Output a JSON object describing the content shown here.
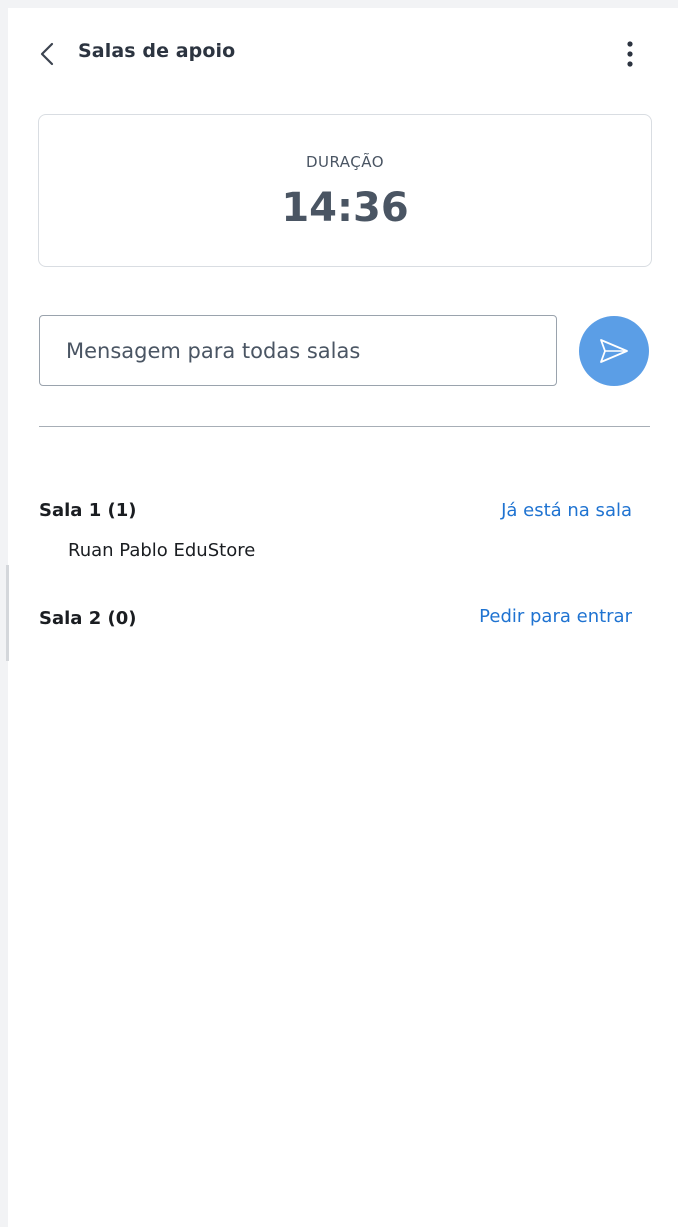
{
  "header": {
    "title": "Salas de apoio",
    "back_icon": "chevron-left-icon",
    "menu_icon": "more-vertical-icon"
  },
  "duration": {
    "label": "DURAÇÃO",
    "value": "14:36"
  },
  "message": {
    "placeholder": "Mensagem para todas salas",
    "value": "",
    "send_icon": "send-icon",
    "send_color": "#5b9ee6"
  },
  "rooms": [
    {
      "name": "Sala 1 (1)",
      "action": "Já está na sala",
      "participants": [
        "Ruan Pablo EduStore"
      ]
    },
    {
      "name": "Sala 2 (0)",
      "action": "Pedir para entrar",
      "participants": []
    }
  ],
  "colors": {
    "link": "#1f73d1",
    "accent": "#5b9ee6"
  }
}
